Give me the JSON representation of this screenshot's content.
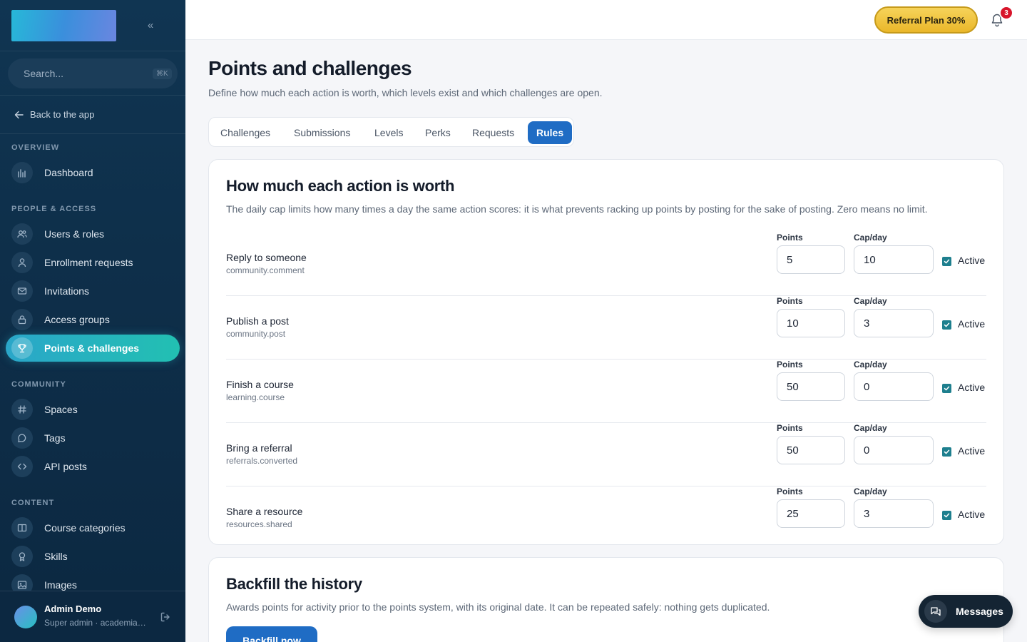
{
  "sidebar": {
    "collapse_icon": "«",
    "search": {
      "placeholder": "Search...",
      "shortcut": "⌘K"
    },
    "back_label": "Back to the app",
    "sections": {
      "overview": "OVERVIEW",
      "people": "PEOPLE & ACCESS",
      "community": "COMMUNITY",
      "content": "CONTENT"
    },
    "items": [
      {
        "label": "Dashboard",
        "icon": "chart-icon"
      },
      {
        "label": "Users & roles",
        "icon": "users-icon"
      },
      {
        "label": "Enrollment requests",
        "icon": "user-icon"
      },
      {
        "label": "Invitations",
        "icon": "mail-icon"
      },
      {
        "label": "Access groups",
        "icon": "lock-icon"
      },
      {
        "label": "Points & challenges",
        "icon": "trophy-icon",
        "active": true
      },
      {
        "label": "Spaces",
        "icon": "hash-icon"
      },
      {
        "label": "Tags",
        "icon": "chat-icon"
      },
      {
        "label": "API posts",
        "icon": "code-icon"
      },
      {
        "label": "Course categories",
        "icon": "book-icon"
      },
      {
        "label": "Skills",
        "icon": "badge-icon"
      },
      {
        "label": "Images",
        "icon": "image-icon"
      }
    ],
    "user": {
      "name": "Admin Demo",
      "role": "Super admin · academia-demo"
    }
  },
  "header": {
    "referral_label": "Referral Plan 30%",
    "notification_count": "3"
  },
  "main": {
    "title": "Points and challenges",
    "subtitle": "Define how much each action is worth, which levels exist and which challenges are open.",
    "tabs": [
      "Challenges",
      "Submissions",
      "Levels",
      "Perks",
      "Requests",
      "Rules"
    ],
    "active_tab": "Rules",
    "rules_card": {
      "title": "How much each action is worth",
      "description": "The daily cap limits how many times a day the same action scores: it is what prevents racking up points by posting for the sake of posting. Zero means no limit.",
      "points_label": "Points",
      "cap_label": "Cap/day",
      "active_label": "Active",
      "rules": [
        {
          "label": "Reply to someone",
          "key": "community.comment",
          "points": "5",
          "cap": "10",
          "active": true
        },
        {
          "label": "Publish a post",
          "key": "community.post",
          "points": "10",
          "cap": "3",
          "active": true
        },
        {
          "label": "Finish a course",
          "key": "learning.course",
          "points": "50",
          "cap": "0",
          "active": true
        },
        {
          "label": "Bring a referral",
          "key": "referrals.converted",
          "points": "50",
          "cap": "0",
          "active": true
        },
        {
          "label": "Share a resource",
          "key": "resources.shared",
          "points": "25",
          "cap": "3",
          "active": true
        }
      ]
    },
    "backfill_card": {
      "title": "Backfill the history",
      "description": "Awards points for activity prior to the points system, with its original date. It can be repeated safely: nothing gets duplicated.",
      "button_label": "Backfill now"
    }
  },
  "messages_label": "Messages",
  "colors": {
    "accent": "#1f6cc4",
    "active_nav": "#2aa6c9",
    "referral": "#eab72a",
    "badge": "#d8152b"
  }
}
